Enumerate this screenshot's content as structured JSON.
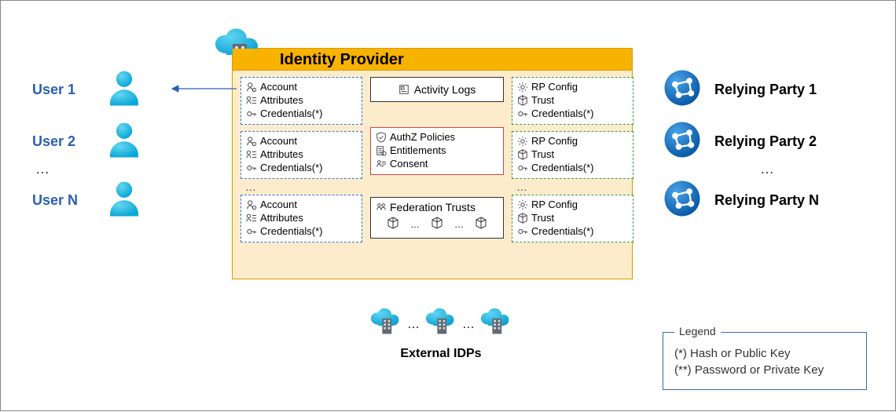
{
  "title": "Identity Provider",
  "users": {
    "items": [
      "User 1",
      "User 2",
      "User N"
    ],
    "ellipsis": "…"
  },
  "relyingParties": {
    "items": [
      "Relying Party 1",
      "Relying Party 2",
      "Relying Party N"
    ],
    "ellipsis": "…"
  },
  "userBox": {
    "account": "Account",
    "attributes": "Attributes",
    "credentials": "Credentials(*)"
  },
  "rpBox": {
    "config": "RP Config",
    "trust": "Trust",
    "credentials": "Credentials(*)"
  },
  "activityLogs": "Activity Logs",
  "authz": {
    "policies": "AuthZ Policies",
    "entitlements": "Entitlements",
    "consent": "Consent"
  },
  "federation": {
    "title": "Federation Trusts",
    "dots": "…"
  },
  "externalIdps": "External IDPs",
  "col_dots": "…",
  "legend": {
    "title": "Legend",
    "star": "(*) Hash or Public Key",
    "dstar": "(**) Password or Private Key"
  }
}
